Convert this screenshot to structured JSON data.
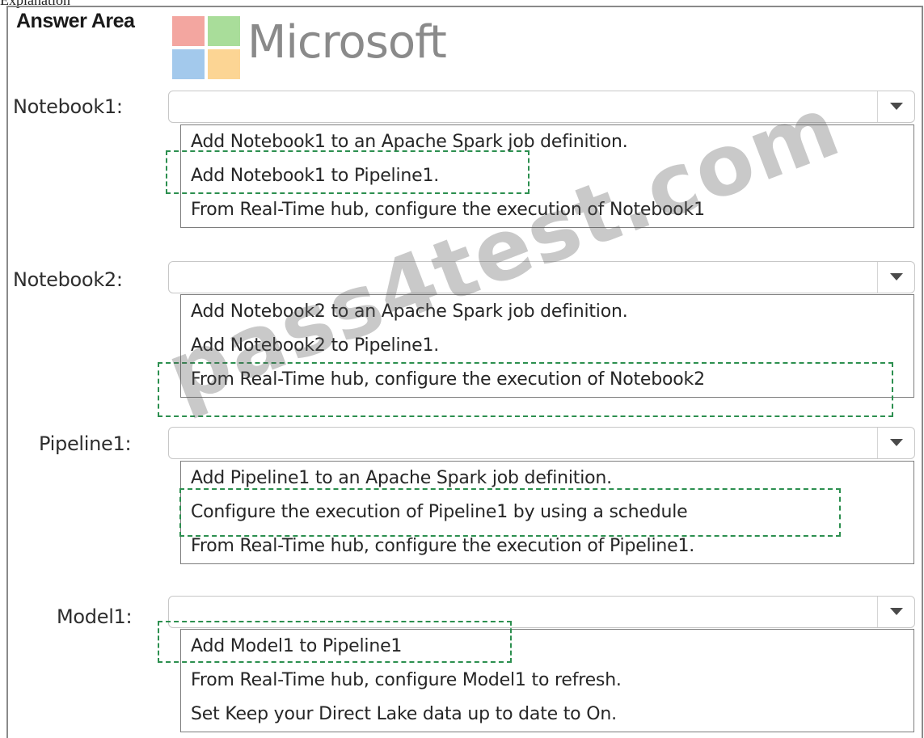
{
  "header_label": "Explanation",
  "answer_area_title": "Answer Area",
  "logo_text": "Microsoft",
  "watermark": "pass4test.com",
  "groups": [
    {
      "label": "Notebook1:",
      "selected": "",
      "options": [
        "Add Notebook1 to an Apache Spark job definition.",
        "Add Notebook1 to Pipeline1.",
        "From Real-Time hub, configure the execution of Notebook1"
      ]
    },
    {
      "label": "Notebook2:",
      "selected": "",
      "options": [
        "Add Notebook2 to an Apache Spark job definition.",
        "Add Notebook2 to Pipeline1.",
        "From Real-Time hub, configure the execution of Notebook2"
      ]
    },
    {
      "label": "Pipeline1:",
      "selected": "",
      "options": [
        "Add Pipeline1 to an Apache Spark job definition.",
        "Configure the execution of Pipeline1 by using a schedule",
        "From Real-Time hub, configure the execution of Pipeline1."
      ]
    },
    {
      "label": "Model1:",
      "selected": "",
      "options": [
        "Add Model1 to Pipeline1",
        "From Real-Time hub, configure Model1 to refresh.",
        "Set Keep your Direct Lake data up to date to On."
      ]
    }
  ]
}
